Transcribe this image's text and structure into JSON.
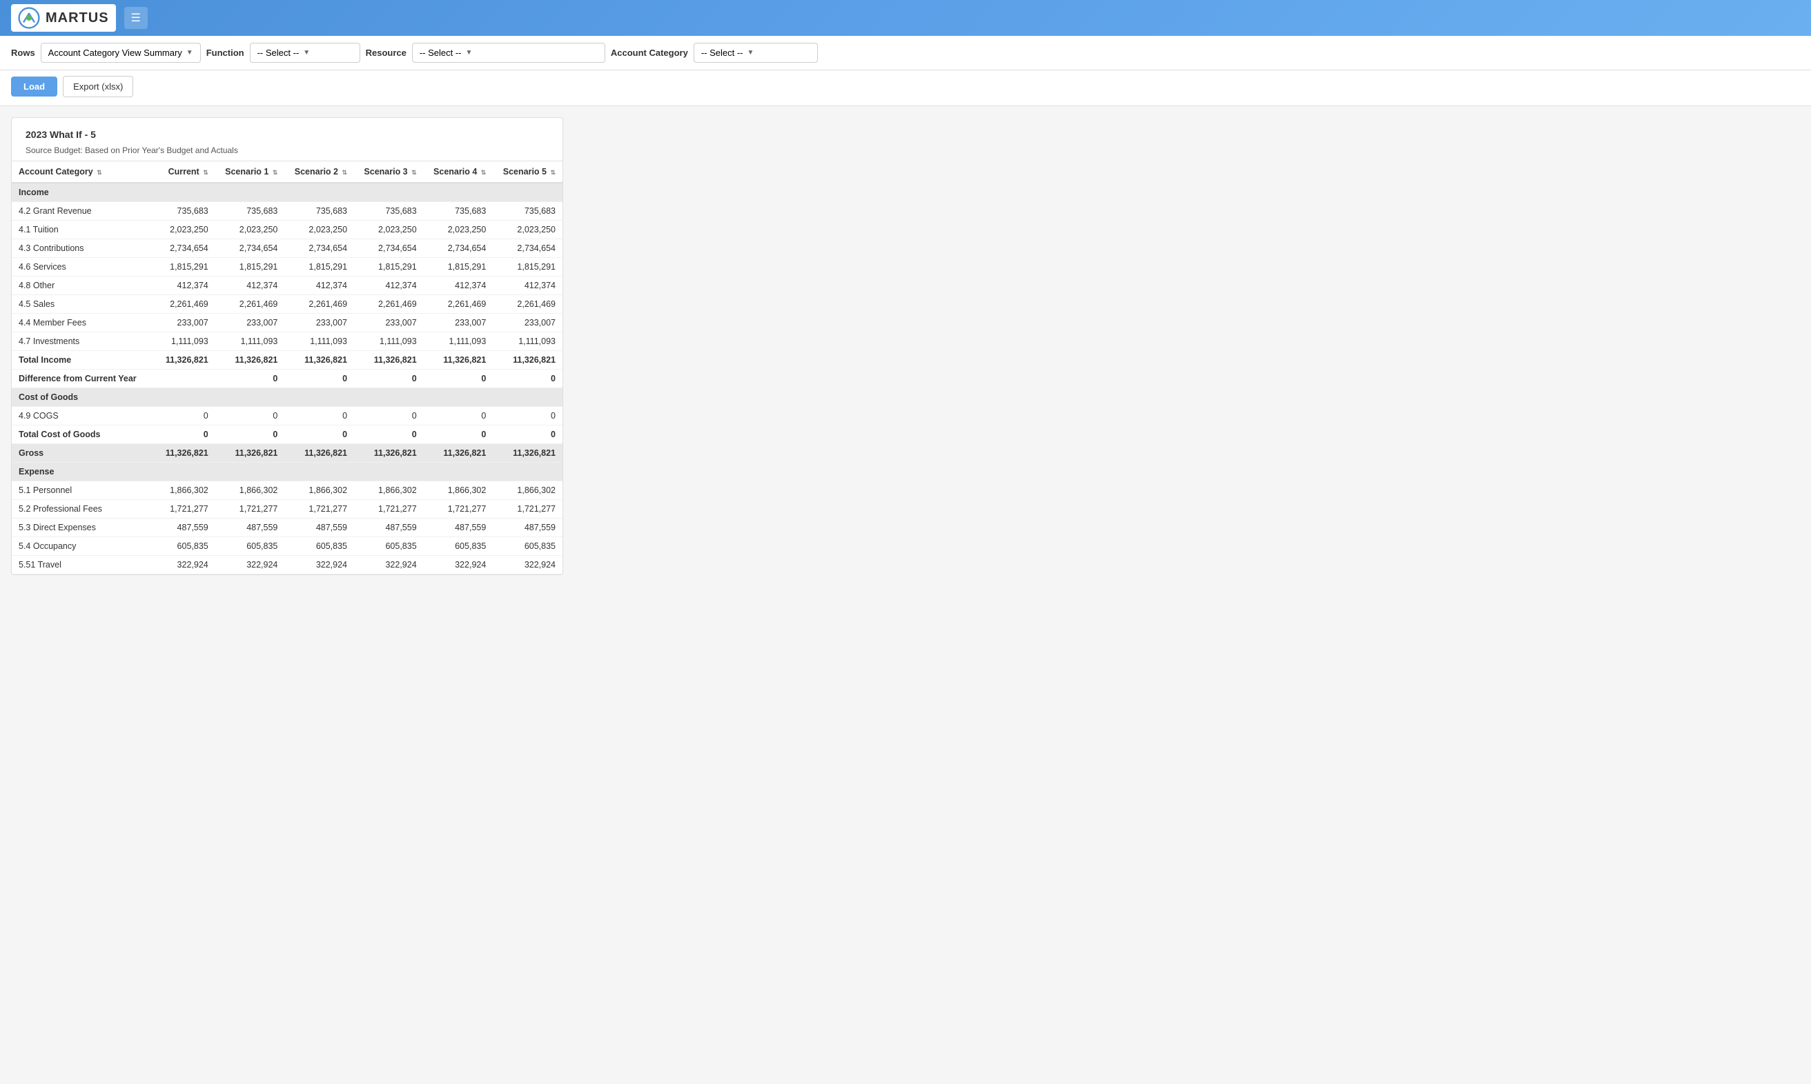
{
  "header": {
    "logo_text": "MARTUS",
    "hamburger_label": "☰"
  },
  "toolbar": {
    "rows_label": "Rows",
    "rows_value": "Account Category View Summary",
    "function_label": "Function",
    "function_value": "-- Select --",
    "resource_label": "Resource",
    "resource_value": "-- Select --",
    "account_category_label": "Account Category",
    "account_category_value": "-- Select --"
  },
  "actions": {
    "load_label": "Load",
    "export_label": "Export (xlsx)"
  },
  "report": {
    "title": "2023 What If - 5",
    "subtitle": "Source Budget: Based on Prior Year's Budget and Actuals",
    "columns": [
      {
        "key": "category",
        "label": "Account Category"
      },
      {
        "key": "current",
        "label": "Current"
      },
      {
        "key": "scenario1",
        "label": "Scenario 1"
      },
      {
        "key": "scenario2",
        "label": "Scenario 2"
      },
      {
        "key": "scenario3",
        "label": "Scenario 3"
      },
      {
        "key": "scenario4",
        "label": "Scenario 4"
      },
      {
        "key": "scenario5",
        "label": "Scenario 5"
      }
    ],
    "sections": [
      {
        "type": "section-header",
        "label": "Income",
        "colspan": 7
      },
      {
        "type": "data",
        "category": "4.2 Grant Revenue",
        "current": "735,683",
        "scenario1": "735,683",
        "scenario2": "735,683",
        "scenario3": "735,683",
        "scenario4": "735,683",
        "scenario5": "735,683"
      },
      {
        "type": "data",
        "category": "4.1 Tuition",
        "current": "2,023,250",
        "scenario1": "2,023,250",
        "scenario2": "2,023,250",
        "scenario3": "2,023,250",
        "scenario4": "2,023,250",
        "scenario5": "2,023,250"
      },
      {
        "type": "data",
        "category": "4.3 Contributions",
        "current": "2,734,654",
        "scenario1": "2,734,654",
        "scenario2": "2,734,654",
        "scenario3": "2,734,654",
        "scenario4": "2,734,654",
        "scenario5": "2,734,654"
      },
      {
        "type": "data",
        "category": "4.6 Services",
        "current": "1,815,291",
        "scenario1": "1,815,291",
        "scenario2": "1,815,291",
        "scenario3": "1,815,291",
        "scenario4": "1,815,291",
        "scenario5": "1,815,291"
      },
      {
        "type": "data",
        "category": "4.8 Other",
        "current": "412,374",
        "scenario1": "412,374",
        "scenario2": "412,374",
        "scenario3": "412,374",
        "scenario4": "412,374",
        "scenario5": "412,374"
      },
      {
        "type": "data",
        "category": "4.5 Sales",
        "current": "2,261,469",
        "scenario1": "2,261,469",
        "scenario2": "2,261,469",
        "scenario3": "2,261,469",
        "scenario4": "2,261,469",
        "scenario5": "2,261,469"
      },
      {
        "type": "data",
        "category": "4.4 Member Fees",
        "current": "233,007",
        "scenario1": "233,007",
        "scenario2": "233,007",
        "scenario3": "233,007",
        "scenario4": "233,007",
        "scenario5": "233,007"
      },
      {
        "type": "data",
        "category": "4.7 Investments",
        "current": "1,111,093",
        "scenario1": "1,111,093",
        "scenario2": "1,111,093",
        "scenario3": "1,111,093",
        "scenario4": "1,111,093",
        "scenario5": "1,111,093"
      },
      {
        "type": "total",
        "category": "Total Income",
        "current": "11,326,821",
        "scenario1": "11,326,821",
        "scenario2": "11,326,821",
        "scenario3": "11,326,821",
        "scenario4": "11,326,821",
        "scenario5": "11,326,821"
      },
      {
        "type": "difference",
        "category": "Difference from Current Year",
        "current": "",
        "scenario1": "0",
        "scenario2": "0",
        "scenario3": "0",
        "scenario4": "0",
        "scenario5": "0"
      },
      {
        "type": "section-header",
        "label": "Cost of Goods",
        "colspan": 7
      },
      {
        "type": "data",
        "category": "4.9 COGS",
        "current": "0",
        "scenario1": "0",
        "scenario2": "0",
        "scenario3": "0",
        "scenario4": "0",
        "scenario5": "0"
      },
      {
        "type": "total",
        "category": "Total Cost of Goods",
        "current": "0",
        "scenario1": "0",
        "scenario2": "0",
        "scenario3": "0",
        "scenario4": "0",
        "scenario5": "0"
      },
      {
        "type": "gross",
        "category": "Gross",
        "current": "11,326,821",
        "scenario1": "11,326,821",
        "scenario2": "11,326,821",
        "scenario3": "11,326,821",
        "scenario4": "11,326,821",
        "scenario5": "11,326,821"
      },
      {
        "type": "section-header",
        "label": "Expense",
        "colspan": 7
      },
      {
        "type": "data",
        "category": "5.1 Personnel",
        "current": "1,866,302",
        "scenario1": "1,866,302",
        "scenario2": "1,866,302",
        "scenario3": "1,866,302",
        "scenario4": "1,866,302",
        "scenario5": "1,866,302"
      },
      {
        "type": "data",
        "category": "5.2 Professional Fees",
        "current": "1,721,277",
        "scenario1": "1,721,277",
        "scenario2": "1,721,277",
        "scenario3": "1,721,277",
        "scenario4": "1,721,277",
        "scenario5": "1,721,277"
      },
      {
        "type": "data",
        "category": "5.3 Direct Expenses",
        "current": "487,559",
        "scenario1": "487,559",
        "scenario2": "487,559",
        "scenario3": "487,559",
        "scenario4": "487,559",
        "scenario5": "487,559"
      },
      {
        "type": "data",
        "category": "5.4 Occupancy",
        "current": "605,835",
        "scenario1": "605,835",
        "scenario2": "605,835",
        "scenario3": "605,835",
        "scenario4": "605,835",
        "scenario5": "605,835"
      },
      {
        "type": "data",
        "category": "5.51 Travel",
        "current": "322,924",
        "scenario1": "322,924",
        "scenario2": "322,924",
        "scenario3": "322,924",
        "scenario4": "322,924",
        "scenario5": "322,924"
      }
    ]
  }
}
